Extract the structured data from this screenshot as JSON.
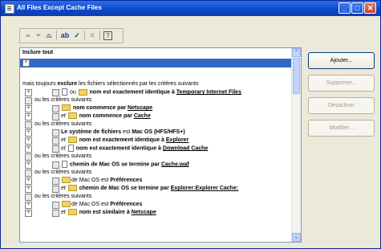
{
  "window": {
    "title": "All Files Except Cache Files"
  },
  "toolbar": {
    "icons": [
      "up-icon",
      "down-icon",
      "delete-icon",
      "rename-icon",
      "check-icon",
      "close-icon",
      "help-icon"
    ]
  },
  "list": {
    "include_all": "Inclure tout",
    "exclude_header_pre": "mais toujours ",
    "exclude_header_bold": "exclure",
    "exclude_header_post": " les fichiers sélectionnés par les critères suivants",
    "ou": "ou",
    "et": "et",
    "ou_les_criteres": "ou les critères suivants",
    "r1": {
      "pre": "ou",
      "mid": " nom est exactement identique à ",
      "link": "Temporary Internet Files"
    },
    "r2": {
      "mid": " nom commence par ",
      "link": "Netscape"
    },
    "r3": {
      "mid": " nom commence par ",
      "link": "Cache"
    },
    "r4": {
      "pre": "Le système de fichiers",
      "mid": " est ",
      "val": "Mac OS (HFS/HFS+)"
    },
    "r5": {
      "mid": " nom est exactement identique à ",
      "link": "Explorer"
    },
    "r6": {
      "mid": " nom est exactement identique à ",
      "link": "Download Cache"
    },
    "r7": {
      "mid": " chemin de Mac OS ",
      "op": "se termine par ",
      "link": "Cache.waf"
    },
    "r8": {
      "mid": "de Mac OS est ",
      "val": "Préférences"
    },
    "r9": {
      "mid": " chemin de Mac OS ",
      "op": "se termine par ",
      "link": "Explorer:Explorer Cache:"
    },
    "r10": {
      "mid": "de Mac OS est ",
      "val": "Préférences"
    },
    "r11": {
      "mid": " nom est similaire à ",
      "link": "Netscape"
    }
  },
  "buttons": {
    "add": "Ajouter...",
    "remove": "Supprimer...",
    "disable": "Désactiver",
    "modify": "Modifier..."
  }
}
